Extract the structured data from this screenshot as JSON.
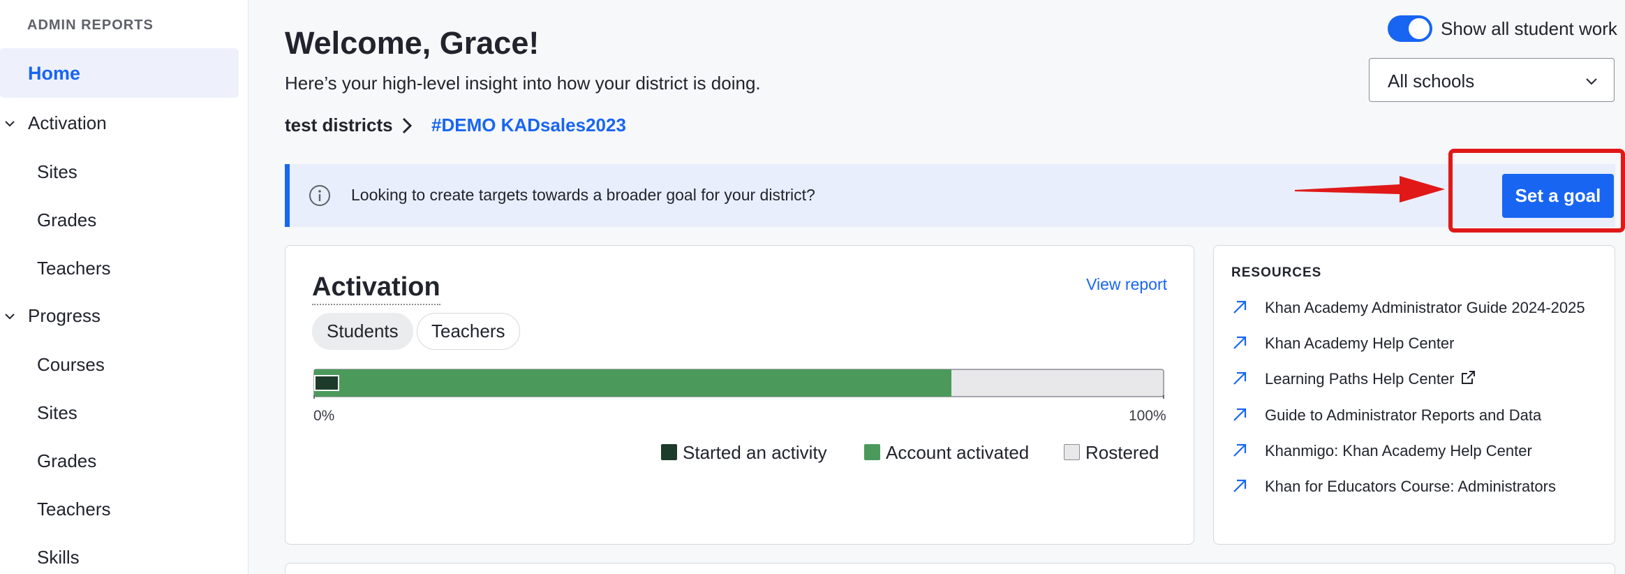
{
  "sidebar": {
    "header": "ADMIN REPORTS",
    "home": "Home",
    "groups": [
      {
        "label": "Activation",
        "items": [
          "Sites",
          "Grades",
          "Teachers"
        ]
      },
      {
        "label": "Progress",
        "items": [
          "Courses",
          "Sites",
          "Grades",
          "Teachers",
          "Skills"
        ]
      }
    ]
  },
  "header": {
    "title": "Welcome, Grace!",
    "subtitle": "Here’s your high-level insight into how your district is doing.",
    "breadcrumb": [
      "test districts",
      "#DEMO KADsales2023"
    ],
    "toggle_label": "Show all student work",
    "toggle_on": true,
    "school_select": "All schools"
  },
  "banner": {
    "text": "Looking to create targets towards a broader goal for your district?",
    "button": "Set a goal"
  },
  "activation": {
    "title": "Activation",
    "view_report": "View report",
    "tabs": [
      "Students",
      "Teachers"
    ],
    "active_tab": "Students",
    "started_fraction": 0.028,
    "activated_fraction": 0.75,
    "min_label": "0%",
    "max_label": "100%",
    "legend": [
      "Started an activity",
      "Account activated",
      "Rostered"
    ],
    "colors": {
      "started": "#1c3b2a",
      "activated": "#4b9a5c",
      "rostered": "#e8e8ea"
    }
  },
  "resources": {
    "heading": "RESOURCES",
    "links": [
      "Khan Academy Administrator Guide 2024-2025",
      "Khan Academy Help Center",
      "Learning Paths Help Center",
      "Guide to Administrator Reports and Data",
      "Khanmigo: Khan Academy Help Center",
      "Khan for Educators Course: Administrators"
    ]
  },
  "colors": {
    "accent": "#1865f2",
    "annotation": "#e01818"
  }
}
